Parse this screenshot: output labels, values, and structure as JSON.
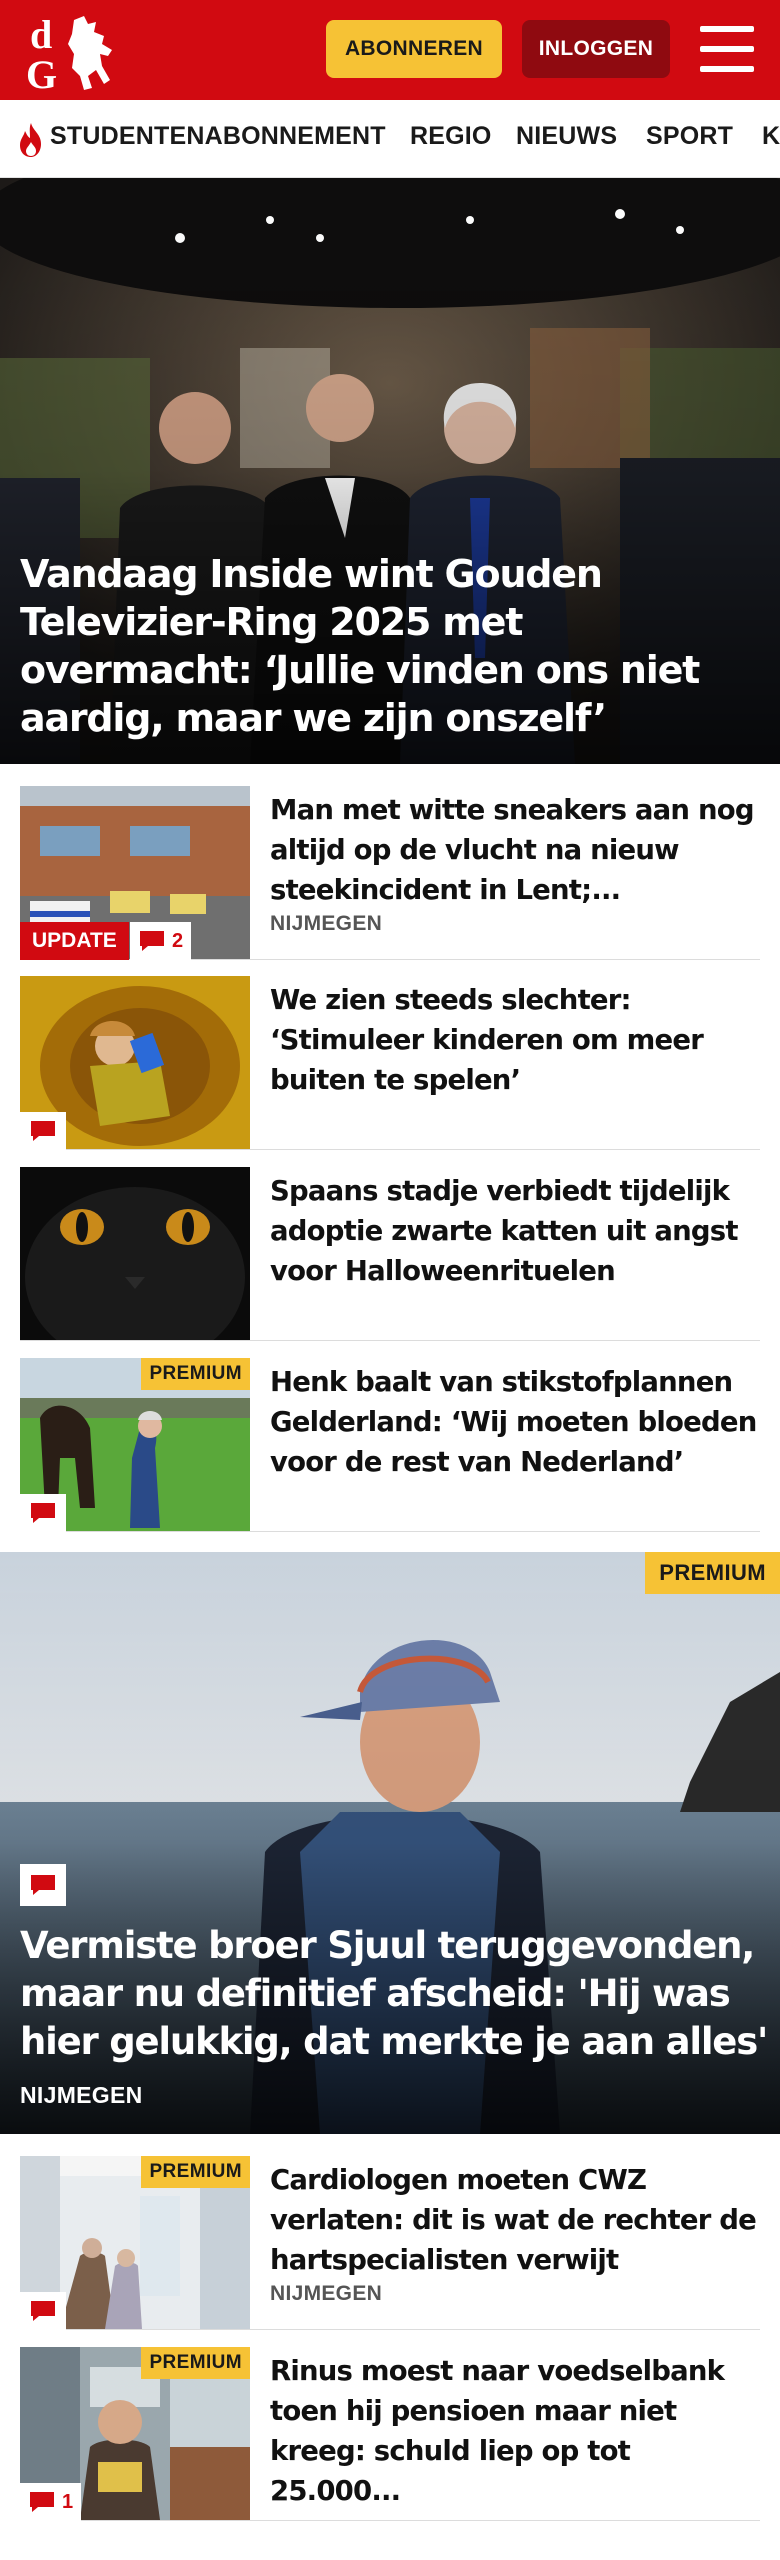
{
  "header": {
    "logo_text": "dG",
    "subscribe_label": "ABONNEREN",
    "login_label": "INLOGGEN",
    "brand_color": "#d10a11",
    "accent_color": "#f6c235"
  },
  "nav": {
    "items": [
      "STUDENTENABONNEMENT",
      "REGIO",
      "NIEUWS",
      "SPORT",
      "K"
    ]
  },
  "hero": {
    "title": "Vandaag Inside wint Gouden Televizier-Ring 2025 met overmacht: ‘Jullie vinden ons niet aardig, maar we zijn onszelf’"
  },
  "articles": [
    {
      "title": "Man met witte sneakers aan nog altijd op de vlucht na nieuw steekincident in Lent;...",
      "category": "NIJMEGEN",
      "update_label": "UPDATE",
      "comments": "2"
    },
    {
      "title": "We zien steeds slechter: ‘Stimuleer kinderen om meer buiten te spelen’"
    },
    {
      "title": "Spaans stadje verbiedt tijdelijk adoptie zwarte katten uit angst voor Halloweenrituelen"
    },
    {
      "title": "Henk baalt van stikstofplannen Gelderland: ‘Wij moeten bloeden voor de rest van Nederland’",
      "premium_label": "PREMIUM"
    }
  ],
  "feature": {
    "title": "Vermiste broer Sjuul teruggevonden, maar nu definitief afscheid: 'Hij was hier gelukkig, dat merkte je aan alles'",
    "category": "NIJMEGEN",
    "premium_label": "PREMIUM"
  },
  "articles_bottom": [
    {
      "title": "Cardiologen moeten CWZ verlaten: dit is wat de rechter de hartspecialisten verwijt",
      "category": "NIJMEGEN",
      "premium_label": "PREMIUM"
    },
    {
      "title": "Rinus moest naar voedselbank toen hij pensioen maar niet kreeg: schuld liep op tot 25.000...",
      "premium_label": "PREMIUM",
      "comments": "1"
    }
  ]
}
